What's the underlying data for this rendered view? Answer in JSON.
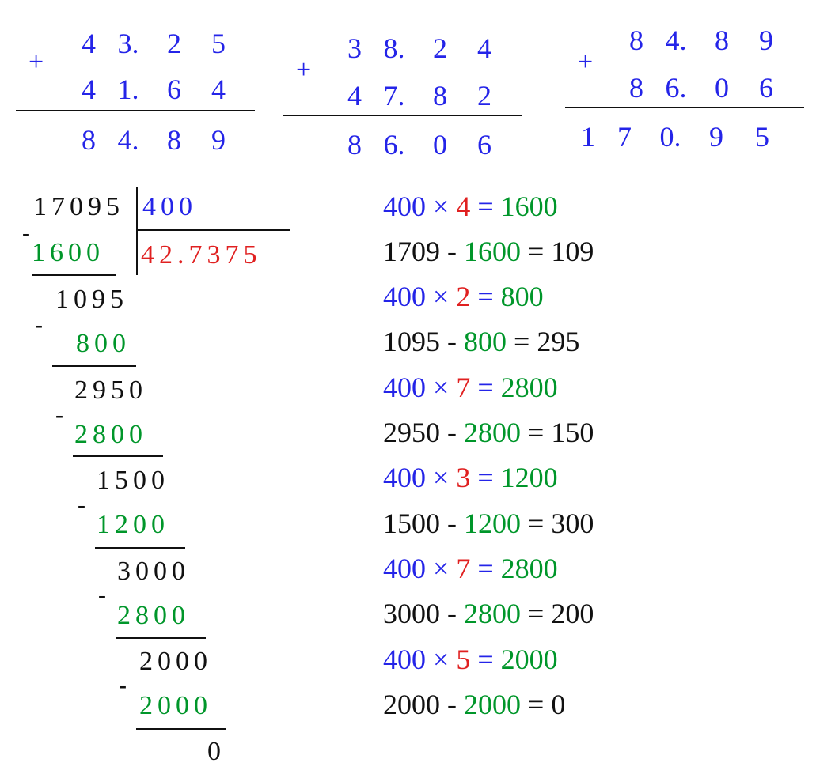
{
  "additions": [
    {
      "operator": "+",
      "top": [
        "4",
        "3.",
        "2",
        "5"
      ],
      "bottom": [
        "4",
        "1.",
        "6",
        "4"
      ],
      "sum": [
        "8",
        "4.",
        "8",
        "9"
      ]
    },
    {
      "operator": "+",
      "top": [
        "3",
        "8.",
        "2",
        "4"
      ],
      "bottom": [
        "4",
        "7.",
        "8",
        "2"
      ],
      "sum": [
        "8",
        "6.",
        "0",
        "6"
      ]
    },
    {
      "operator": "+",
      "top": [
        "8",
        "4.",
        "8",
        "9"
      ],
      "bottom": [
        "8",
        "6.",
        "0",
        "6"
      ],
      "sum": [
        "1",
        "7",
        "0.",
        "9",
        "5"
      ]
    }
  ],
  "division": {
    "dividend": "17095",
    "divisor": "400",
    "quotient": "42.7375",
    "minus_sign": "-",
    "steps": [
      {
        "subtract": "1600",
        "remainder": "1095"
      },
      {
        "subtract": "800",
        "remainder": "2950"
      },
      {
        "subtract": "2800",
        "remainder": "1500"
      },
      {
        "subtract": "1200",
        "remainder": "3000"
      },
      {
        "subtract": "2800",
        "remainder": "2000"
      },
      {
        "subtract": "2000",
        "remainder": "0"
      }
    ]
  },
  "work": [
    {
      "type": "mul",
      "a": "400",
      "op": "×",
      "b": "4",
      "eq": "=",
      "r": "1600"
    },
    {
      "type": "sub",
      "a": "1709",
      "op": "-",
      "b": "1600",
      "eq": "=",
      "r": "109"
    },
    {
      "type": "mul",
      "a": "400",
      "op": "×",
      "b": "2",
      "eq": "=",
      "r": "800"
    },
    {
      "type": "sub",
      "a": "1095",
      "op": "-",
      "b": "800",
      "eq": "=",
      "r": "295"
    },
    {
      "type": "mul",
      "a": "400",
      "op": "×",
      "b": "7",
      "eq": "=",
      "r": "2800"
    },
    {
      "type": "sub",
      "a": "2950",
      "op": "-",
      "b": "2800",
      "eq": "=",
      "r": "150"
    },
    {
      "type": "mul",
      "a": "400",
      "op": "×",
      "b": "3",
      "eq": "=",
      "r": "1200"
    },
    {
      "type": "sub",
      "a": "1500",
      "op": "-",
      "b": "1200",
      "eq": "=",
      "r": "300"
    },
    {
      "type": "mul",
      "a": "400",
      "op": "×",
      "b": "7",
      "eq": "=",
      "r": "2800"
    },
    {
      "type": "sub",
      "a": "3000",
      "op": "-",
      "b": "2800",
      "eq": "=",
      "r": "200"
    },
    {
      "type": "mul",
      "a": "400",
      "op": "×",
      "b": "5",
      "eq": "=",
      "r": "2000"
    },
    {
      "type": "sub",
      "a": "2000",
      "op": "-",
      "b": "2000",
      "eq": "=",
      "r": "0"
    }
  ]
}
